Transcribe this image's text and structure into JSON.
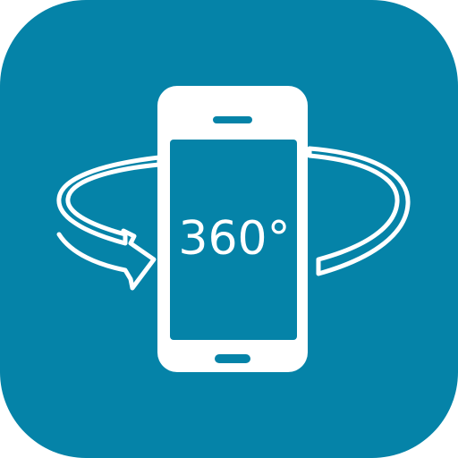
{
  "icon": {
    "label": "360°",
    "background_color": "#0583A8",
    "foreground_color": "#FFFFFF",
    "depicts": "smartphone-with-rotation-arrow"
  }
}
